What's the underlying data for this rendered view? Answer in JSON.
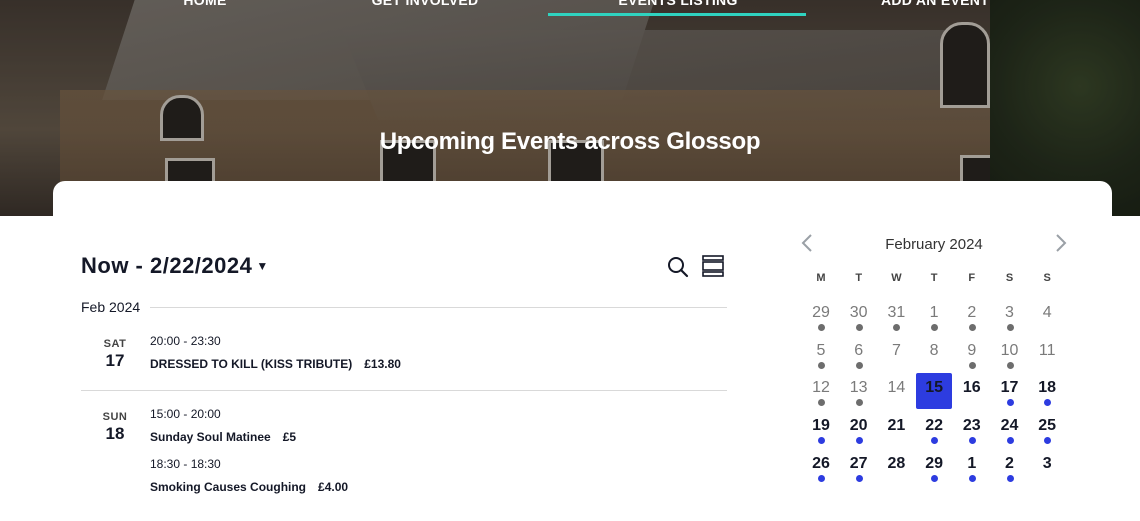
{
  "nav": {
    "items": [
      "HOME",
      "GET INVOLVED",
      "EVENTS LISTING",
      "ADD AN EVENT"
    ],
    "active_index": 2
  },
  "hero": {
    "title": "Upcoming Events across Glossop"
  },
  "listing": {
    "range_label": "Now - 2/22/2024",
    "month_header": "Feb 2024",
    "days": [
      {
        "dow": "SAT",
        "num": "17",
        "events": [
          {
            "time": "20:00 - 23:30",
            "title": "DRESSED TO KILL (KISS TRIBUTE)",
            "price": "£13.80"
          }
        ]
      },
      {
        "dow": "SUN",
        "num": "18",
        "events": [
          {
            "time": "15:00 - 20:00",
            "title": "Sunday Soul Matinee",
            "price": "£5"
          },
          {
            "time": "18:30 - 18:30",
            "title": "Smoking Causes Coughing",
            "price": "£4.00"
          }
        ]
      }
    ]
  },
  "calendar": {
    "month_label": "February 2024",
    "dow": [
      "M",
      "T",
      "W",
      "T",
      "F",
      "S",
      "S"
    ],
    "weeks": [
      [
        {
          "d": "29",
          "s": "past",
          "dot": "grey"
        },
        {
          "d": "30",
          "s": "past",
          "dot": "grey"
        },
        {
          "d": "31",
          "s": "past",
          "dot": "grey"
        },
        {
          "d": "1",
          "s": "past",
          "dot": "grey"
        },
        {
          "d": "2",
          "s": "past",
          "dot": "grey"
        },
        {
          "d": "3",
          "s": "past",
          "dot": "grey"
        },
        {
          "d": "4",
          "s": "past",
          "dot": ""
        }
      ],
      [
        {
          "d": "5",
          "s": "past",
          "dot": "grey"
        },
        {
          "d": "6",
          "s": "past",
          "dot": "grey"
        },
        {
          "d": "7",
          "s": "past",
          "dot": ""
        },
        {
          "d": "8",
          "s": "past",
          "dot": ""
        },
        {
          "d": "9",
          "s": "past",
          "dot": "grey"
        },
        {
          "d": "10",
          "s": "past",
          "dot": "grey"
        },
        {
          "d": "11",
          "s": "past",
          "dot": ""
        }
      ],
      [
        {
          "d": "12",
          "s": "past",
          "dot": "grey"
        },
        {
          "d": "13",
          "s": "past",
          "dot": "grey"
        },
        {
          "d": "14",
          "s": "past",
          "dot": ""
        },
        {
          "d": "15",
          "s": "today",
          "dot": ""
        },
        {
          "d": "16",
          "s": "future",
          "dot": ""
        },
        {
          "d": "17",
          "s": "future",
          "dot": "blue"
        },
        {
          "d": "18",
          "s": "future",
          "dot": "blue"
        }
      ],
      [
        {
          "d": "19",
          "s": "future",
          "dot": "blue"
        },
        {
          "d": "20",
          "s": "future",
          "dot": "blue"
        },
        {
          "d": "21",
          "s": "future",
          "dot": ""
        },
        {
          "d": "22",
          "s": "future",
          "dot": "blue"
        },
        {
          "d": "23",
          "s": "future",
          "dot": "blue"
        },
        {
          "d": "24",
          "s": "future",
          "dot": "blue"
        },
        {
          "d": "25",
          "s": "future",
          "dot": "blue"
        }
      ],
      [
        {
          "d": "26",
          "s": "future",
          "dot": "blue"
        },
        {
          "d": "27",
          "s": "future",
          "dot": "blue"
        },
        {
          "d": "28",
          "s": "future",
          "dot": ""
        },
        {
          "d": "29",
          "s": "future",
          "dot": "blue"
        },
        {
          "d": "1",
          "s": "future",
          "dot": "blue"
        },
        {
          "d": "2",
          "s": "future",
          "dot": "blue"
        },
        {
          "d": "3",
          "s": "future",
          "dot": ""
        }
      ]
    ]
  },
  "icons": {
    "search": "search-icon",
    "view": "list-view-icon",
    "prev": "chevron-left-icon",
    "next": "chevron-right-icon"
  },
  "colors": {
    "accent": "#2fd3c0",
    "today": "#2d3ce0",
    "event_dot": "#2d3ce0",
    "past_dot": "#6d6d6d"
  }
}
